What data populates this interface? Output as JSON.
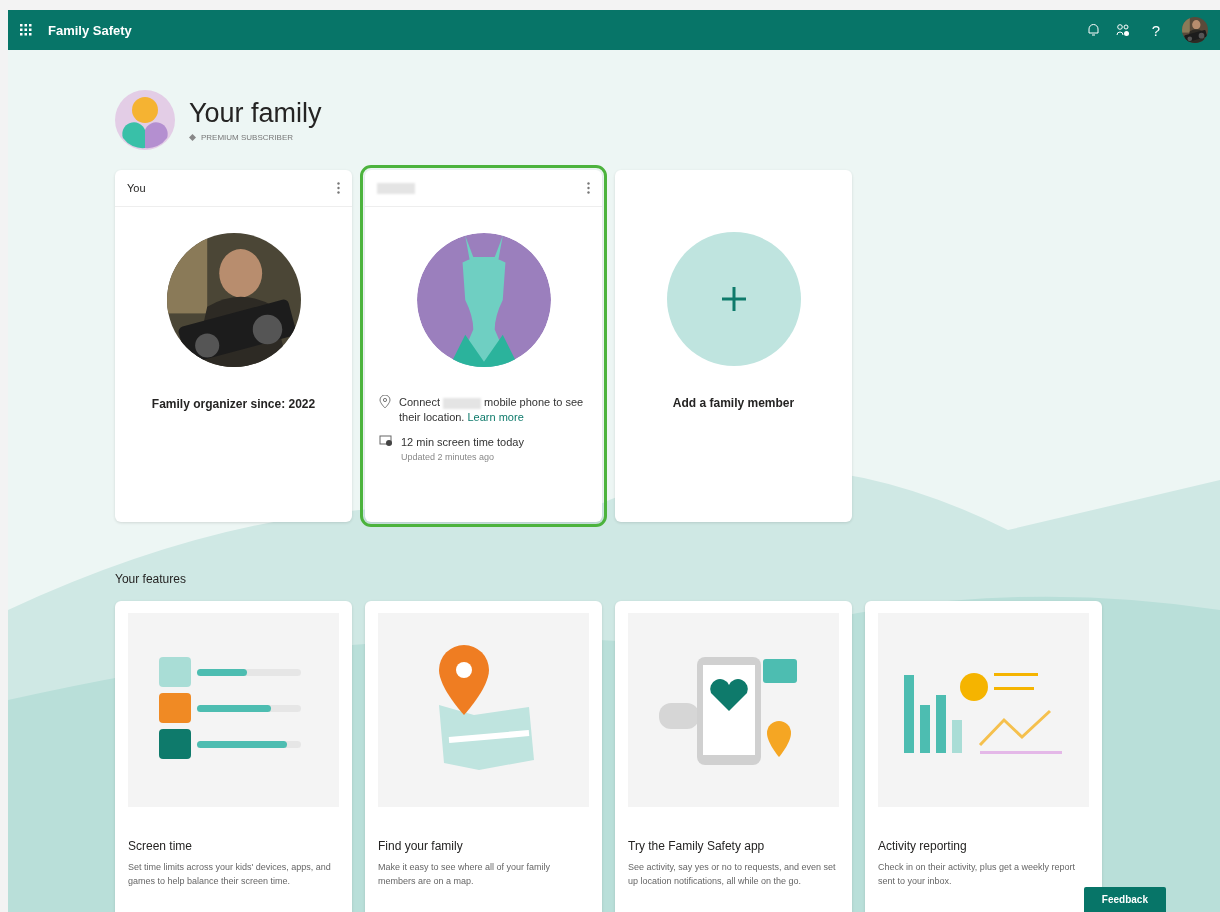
{
  "app": {
    "title": "Family Safety",
    "help": "?"
  },
  "header": {
    "title": "Your family",
    "subscription": "PREMIUM SUBSCRIBER"
  },
  "members": [
    {
      "kind": "self",
      "label": "You",
      "caption": "Family organizer since: 2022",
      "selected": false
    },
    {
      "kind": "child",
      "selected": true,
      "location_before": "Connect",
      "location_after": "mobile phone to see their location.",
      "link": "Learn more",
      "screen_time": "12 min screen time today",
      "updated": "Updated 2 minutes ago"
    },
    {
      "kind": "add",
      "caption": "Add a family member",
      "selected": false
    }
  ],
  "features_title": "Your features",
  "features": [
    {
      "kind": "screen_time",
      "title": "Screen time",
      "description": "Set time limits across your kids' devices, apps, and games to help balance their screen time."
    },
    {
      "kind": "find",
      "title": "Find your family",
      "description": "Make it easy to see where all of your family members are on a map."
    },
    {
      "kind": "app",
      "title": "Try the Family Safety app",
      "description": "See activity, say yes or no to requests, and even set up location notifications, all while on the go."
    },
    {
      "kind": "activity",
      "title": "Activity reporting",
      "description": "Check in on their activity, plus get a weekly report sent to your inbox."
    }
  ],
  "feedback": "Feedback"
}
